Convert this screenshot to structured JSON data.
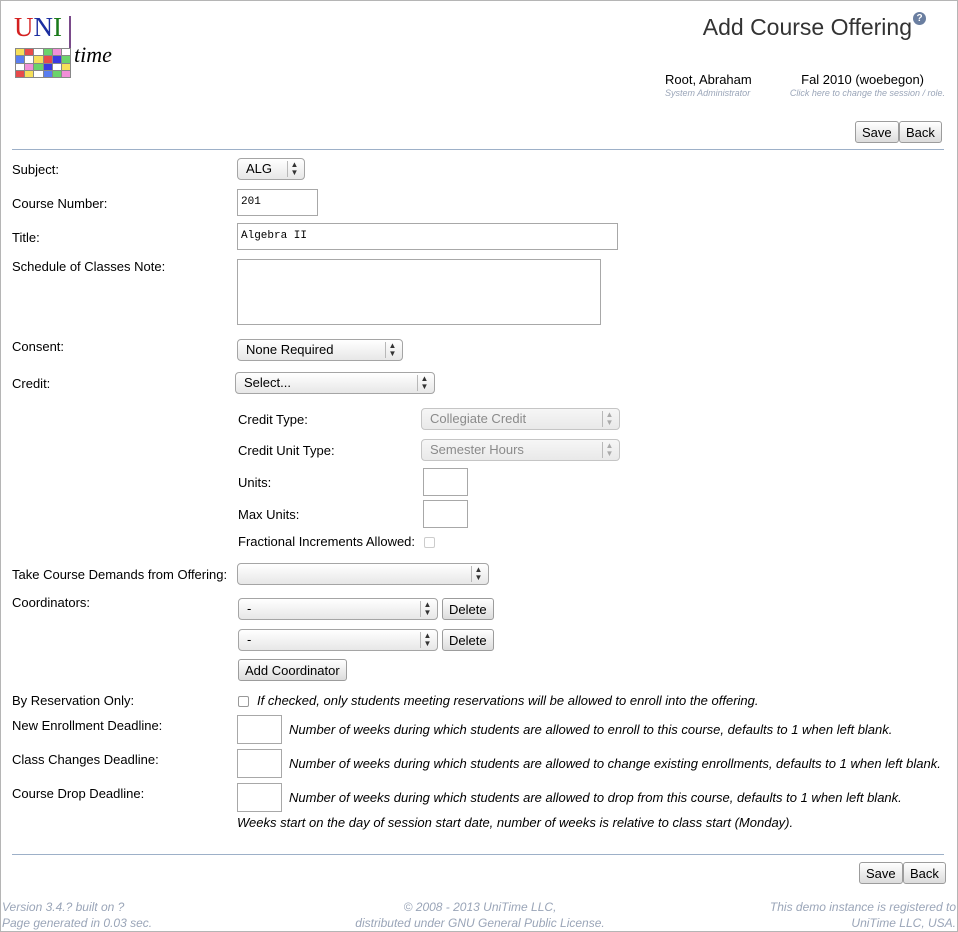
{
  "logo": {
    "uni": "UNI",
    "time": "time"
  },
  "header": {
    "title": "Add Course Offering",
    "user_name": "Root, Abraham",
    "user_role": "System Administrator",
    "session": "Fal 2010 (woebegon)",
    "session_hint": "Click here to change the session / role."
  },
  "buttons": {
    "save": "Save",
    "back": "Back",
    "delete": "Delete",
    "add_coordinator": "Add Coordinator"
  },
  "form": {
    "subject": {
      "label": "Subject:",
      "value": "ALG"
    },
    "course_number": {
      "label": "Course Number:",
      "value": "201"
    },
    "title": {
      "label": "Title:",
      "value": "Algebra II"
    },
    "schedule_note": {
      "label": "Schedule of Classes Note:",
      "value": ""
    },
    "consent": {
      "label": "Consent:",
      "value": "None Required"
    },
    "credit": {
      "label": "Credit:",
      "value": "Select...",
      "credit_type": {
        "label": "Credit Type:",
        "value": "Collegiate Credit"
      },
      "credit_unit_type": {
        "label": "Credit Unit Type:",
        "value": "Semester Hours"
      },
      "units": {
        "label": "Units:",
        "value": ""
      },
      "max_units": {
        "label": "Max Units:",
        "value": ""
      },
      "fractional": {
        "label": "Fractional Increments Allowed:",
        "checked": false
      }
    },
    "demands": {
      "label": "Take Course Demands from Offering:",
      "value": ""
    },
    "coordinators": {
      "label": "Coordinators:",
      "rows": [
        "-",
        "-"
      ]
    },
    "by_reservation": {
      "label": "By Reservation Only:",
      "checked": false,
      "note": "If checked, only students meeting reservations will be allowed to enroll into the offering."
    },
    "new_enrollment": {
      "label": "New Enrollment Deadline:",
      "value": "",
      "note": "Number of weeks during which students are allowed to enroll to this course, defaults to 1 when left blank."
    },
    "class_changes": {
      "label": "Class Changes Deadline:",
      "value": "",
      "note": "Number of weeks during which students are allowed to change existing enrollments, defaults to 1 when left blank."
    },
    "course_drop": {
      "label": "Course Drop Deadline:",
      "value": "",
      "note": "Number of weeks during which students are allowed to drop from this course, defaults to 1 when left blank."
    },
    "weeks_note": "Weeks start on the day of session start date, number of weeks is relative to class start (Monday)."
  },
  "footer": {
    "version": "Version 3.4.? built on ?",
    "generated": "Page generated in 0.03 sec.",
    "copyright": "© 2008 - 2013 UniTime LLC,",
    "license": "distributed under GNU General Public License.",
    "demo1": "This demo instance is registered to",
    "demo2": "UniTime LLC, USA."
  },
  "colors": {
    "rule": "#9db0c8",
    "hint": "#9aa5b8"
  }
}
